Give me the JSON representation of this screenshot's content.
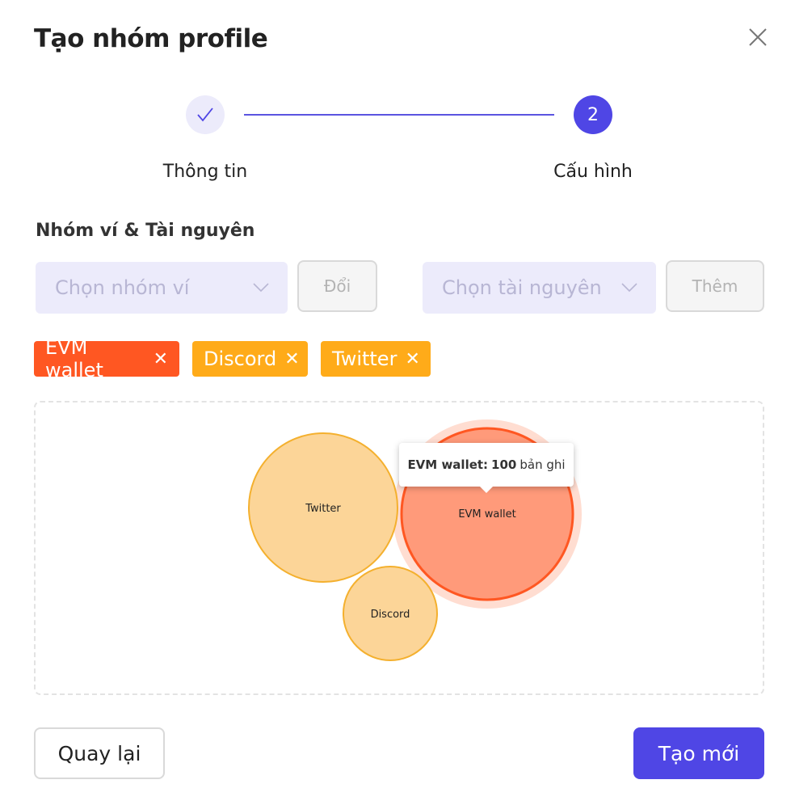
{
  "dialog": {
    "title": "Tạo nhóm profile"
  },
  "stepper": {
    "steps": [
      {
        "label": "Thông tin",
        "status": "done",
        "icon": "check-icon"
      },
      {
        "label": "Cấu hình",
        "status": "active",
        "number": "2"
      }
    ]
  },
  "section": {
    "title": "Nhóm ví & Tài nguyên"
  },
  "wallet_group": {
    "placeholder": "Chọn nhóm ví",
    "button_label": "Đổi"
  },
  "resource": {
    "placeholder": "Chọn tài nguyên",
    "button_label": "Thêm"
  },
  "tags": [
    {
      "label": "EVM wallet",
      "color": "#ff5722"
    },
    {
      "label": "Discord",
      "color": "#ffab19"
    },
    {
      "label": "Twitter",
      "color": "#ffab19"
    }
  ],
  "tooltip": {
    "label": "EVM wallet:",
    "value": "100",
    "unit": "bản ghi"
  },
  "chart_data": {
    "type": "bubble",
    "series": [
      {
        "name": "EVM wallet",
        "value": 100,
        "highlighted": true,
        "fill": "#ff9a7a",
        "stroke": "#ff5722"
      },
      {
        "name": "Twitter",
        "fill": "#fcd598",
        "stroke": "#f4b02e"
      },
      {
        "name": "Discord",
        "fill": "#fcd598",
        "stroke": "#f4b02e"
      }
    ]
  },
  "footer": {
    "back_label": "Quay lại",
    "create_label": "Tạo mới"
  },
  "colors": {
    "primary": "#4f46e5",
    "orange": "#ff5722",
    "amber": "#ffab19"
  }
}
